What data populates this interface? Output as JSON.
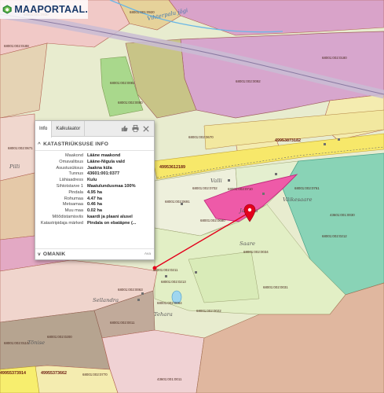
{
  "app": {
    "logo_text": "MAAPORTAAL."
  },
  "map": {
    "river_label": "Vihterpalu jõgi",
    "place_labels": [
      "Jaakna",
      "Väikesaare",
      "Saare",
      "Sellandra",
      "Tehara",
      "Tõnise",
      "Valli",
      "Pilli"
    ],
    "parcel_labels": [
      "68001:001:0930",
      "68001:001:0920",
      "68001:002:0188",
      "68001:002:0180",
      "68001:002:0068",
      "68001:002:0088",
      "68001:002:0091",
      "68001:002:0081",
      "68001:002:0080",
      "68001:002:0092",
      "68001:002:0070",
      "68001:002:0094",
      "68001:002:0671",
      "68001:002:0670",
      "68001:002:0710",
      "68001:002:0702",
      "68001:002:0691",
      "68001:002:0761",
      "68001:002:0680",
      "68001:002:0840",
      "68001:002:0740",
      "68001:002:0070",
      "68001:002:0210",
      "68001:002:0211",
      "68001:002:0212",
      "68001:002:0213",
      "68001:002:0220",
      "68001:002:0250",
      "68001:002:0034",
      "68001:002:0063",
      "68001:002:0064",
      "68001:002:0030",
      "68001:002:0031",
      "68001:002:0022",
      "68001:002:0011",
      "68001:002:0200",
      "68001:002:0110",
      "68001:002:0770",
      "43601:001:0377",
      "43601:001:0011",
      "68001:002:0073",
      "68001:002:0050",
      "68001:002:0051",
      "68001:002:0045",
      "68001:002:0043",
      "43601:001:0030",
      "68001:002:0560"
    ],
    "road_numbers": [
      "49953612189",
      "49953873182",
      "4995361236",
      "49955373914",
      "49955373662"
    ],
    "accent_colors": {
      "marker": "#e3001b",
      "highlight_parcel": "#ee5aa8",
      "road": "#f7e86a"
    }
  },
  "popup": {
    "tabs": [
      "Info",
      "Kalkulaator"
    ],
    "active_tab": "Info",
    "icons": [
      "thumbs-up-icon",
      "print-icon",
      "close-icon"
    ],
    "section_title": "KATASTRIÜKSUSE INFO",
    "fields": [
      {
        "label": "Maakond",
        "value": "Lääne maakond"
      },
      {
        "label": "Omavalitsus",
        "value": "Lääne-Nigula vald"
      },
      {
        "label": "Asustusüksus",
        "value": "Jaakna küla"
      },
      {
        "label": "Tunnus",
        "value": "43601:001:0377"
      },
      {
        "label": "Lähiaadress",
        "value": "Kulu"
      },
      {
        "label": "Sihtotstarve 1",
        "value": "Maatulundusmaa 100%"
      },
      {
        "label": "Pindala",
        "value": "4.95 ha"
      },
      {
        "label": "Rohumaa",
        "value": "4.47 ha"
      },
      {
        "label": "Metsamaa",
        "value": "0.46 ha"
      },
      {
        "label": "Muu maa",
        "value": "0.02 ha"
      },
      {
        "label": "Mõõdistamisviis",
        "value": "kaardi ja plaani alusel"
      },
      {
        "label": "Katastripidaja märked",
        "value": "Pindala on ebatäpne (..."
      }
    ],
    "owner_section": "OMANIK",
    "owner_suffix": "Ava"
  }
}
